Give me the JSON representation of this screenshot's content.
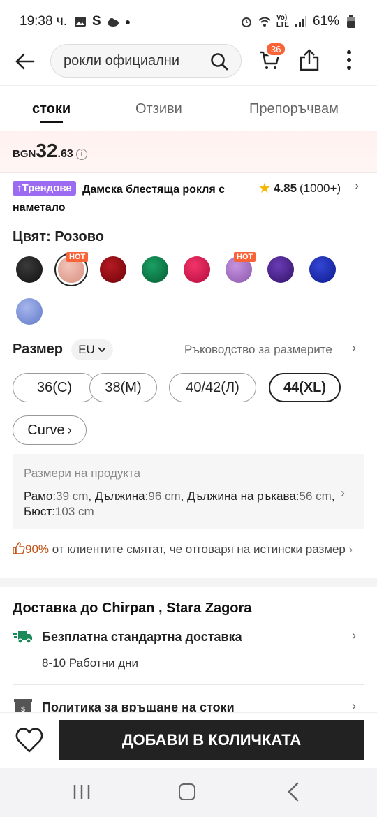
{
  "status_bar": {
    "time": "19:38 ч.",
    "battery": "61%"
  },
  "header": {
    "search_text": "рокли официални",
    "cart_count": "36"
  },
  "tabs": [
    "стоки",
    "Отзиви",
    "Препоръчвам"
  ],
  "price": {
    "currency": "BGN",
    "integer": "32",
    "decimal": ".63"
  },
  "product": {
    "badge": "Трендове",
    "title": "Дамска блестяща рокля с наметало",
    "rating": "4.85",
    "reviews": "(1000+)"
  },
  "color": {
    "label": "Цвят: Розово",
    "hot_label": "HOT",
    "swatches": [
      {
        "name": "black",
        "color": "#1b1b1b"
      },
      {
        "name": "pink",
        "color": "#e6a89a",
        "selected": true,
        "hot": true
      },
      {
        "name": "dark-red",
        "color": "#8e0a12"
      },
      {
        "name": "green",
        "color": "#0b7a47"
      },
      {
        "name": "magenta-red",
        "color": "#d8124b"
      },
      {
        "name": "lavender",
        "color": "#a974c8",
        "hot": true
      },
      {
        "name": "purple",
        "color": "#4a1f8f"
      },
      {
        "name": "royal-blue",
        "color": "#1a2cb0"
      },
      {
        "name": "light-blue",
        "color": "#7d92d8"
      }
    ]
  },
  "size": {
    "label": "Размер",
    "region": "EU",
    "guide": "Ръководство за размерите",
    "options": [
      "36(С)",
      "38(М)",
      "40/42(Л)",
      "44(XL)",
      "Curve"
    ],
    "selected": "44(XL)"
  },
  "measurements": {
    "title": "Размери на продукта",
    "shoulder_label": "Рамо:",
    "shoulder": "39 cm",
    "length_label": "Дължина:",
    "length": "96 cm",
    "sleeve_label": "Дължина на ръкава:",
    "sleeve": "56 cm",
    "bust_label": "Бюст:",
    "bust": "103 cm"
  },
  "fit": {
    "percent": "90%",
    "text": "от клиентите смятат, че отговаря на истински размер"
  },
  "delivery": {
    "title": "Доставка до Chirpan , Stara Zagora",
    "shipping": "Безплатна стандартна доставка",
    "days": "8-10 Работни дни",
    "return_policy": "Политика за връщане на стоки"
  },
  "actions": {
    "add_to_cart": "ДОБАВИ В КОЛИЧКАТА"
  }
}
